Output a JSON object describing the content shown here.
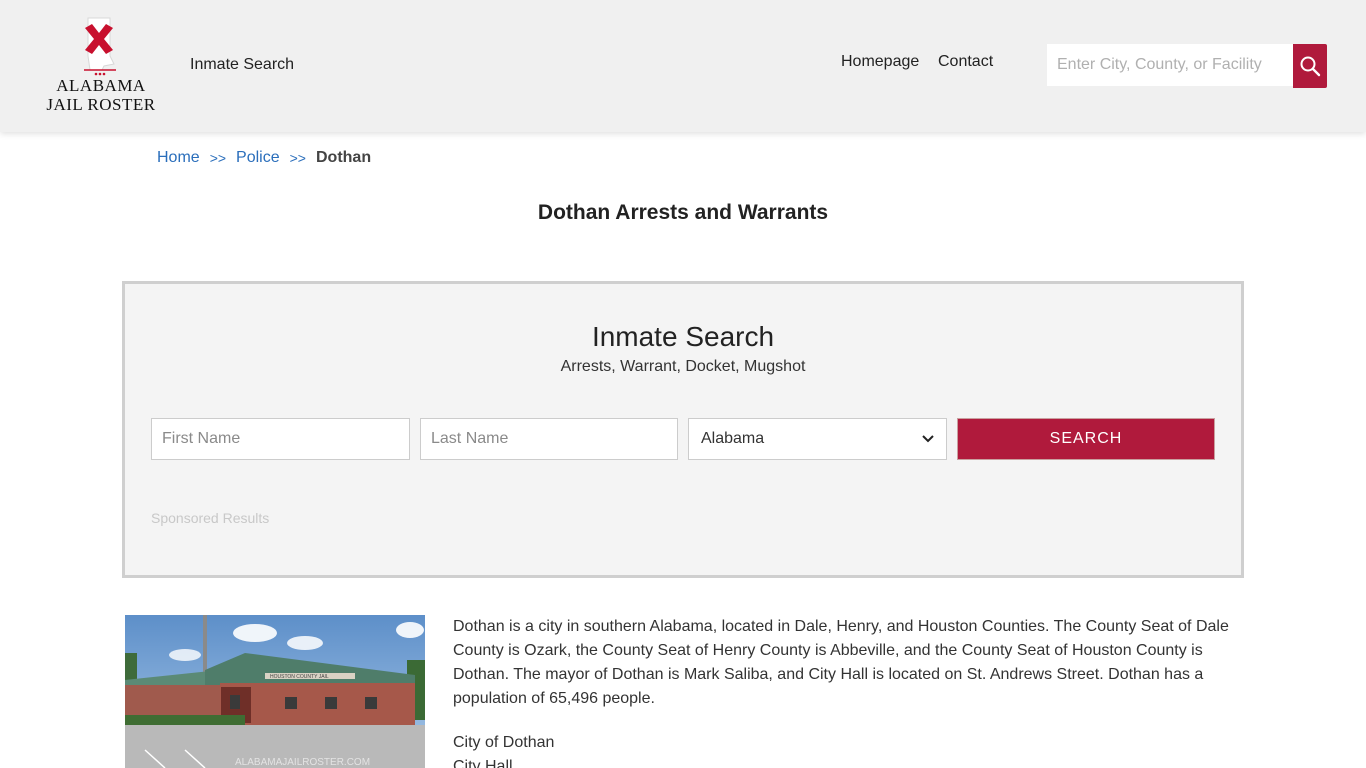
{
  "header": {
    "logo_line1": "ALABAMA",
    "logo_line2": "JAIL ROSTER",
    "nav_inmate_search": "Inmate Search",
    "nav_homepage": "Homepage",
    "nav_contact": "Contact",
    "search_placeholder": "Enter City, County, or Facility",
    "search_icon": "search-icon"
  },
  "breadcrumb": {
    "home": "Home",
    "separator": ">>",
    "police": "Police",
    "current": "Dothan"
  },
  "page_title": "Dothan Arrests and Warrants",
  "search_panel": {
    "title": "Inmate Search",
    "subtitle": "Arrests, Warrant, Docket, Mugshot",
    "first_name_placeholder": "First Name",
    "last_name_placeholder": "Last Name",
    "state_selected": "Alabama",
    "search_button": "SEARCH",
    "sponsored": "Sponsored Results"
  },
  "content": {
    "photo_caption": "HOUSTON COUNTY JAIL",
    "description": "Dothan is a city in southern Alabama, located in Dale, Henry, and Houston Counties. The County Seat of Dale County is Ozark, the County Seat of Henry County is Abbeville, and the County Seat of Houston County is Dothan. The mayor of Dothan is Mark Saliba, and City Hall is located on St. Andrews Street. Dothan has a population of 65,496 people.",
    "city_name": "City of Dothan",
    "city_hall": "City Hall"
  },
  "colors": {
    "brand": "#b01a3c",
    "link": "#2a6ebb",
    "header_bg": "#f0f0f0",
    "panel_bg": "#f4f4f4"
  }
}
